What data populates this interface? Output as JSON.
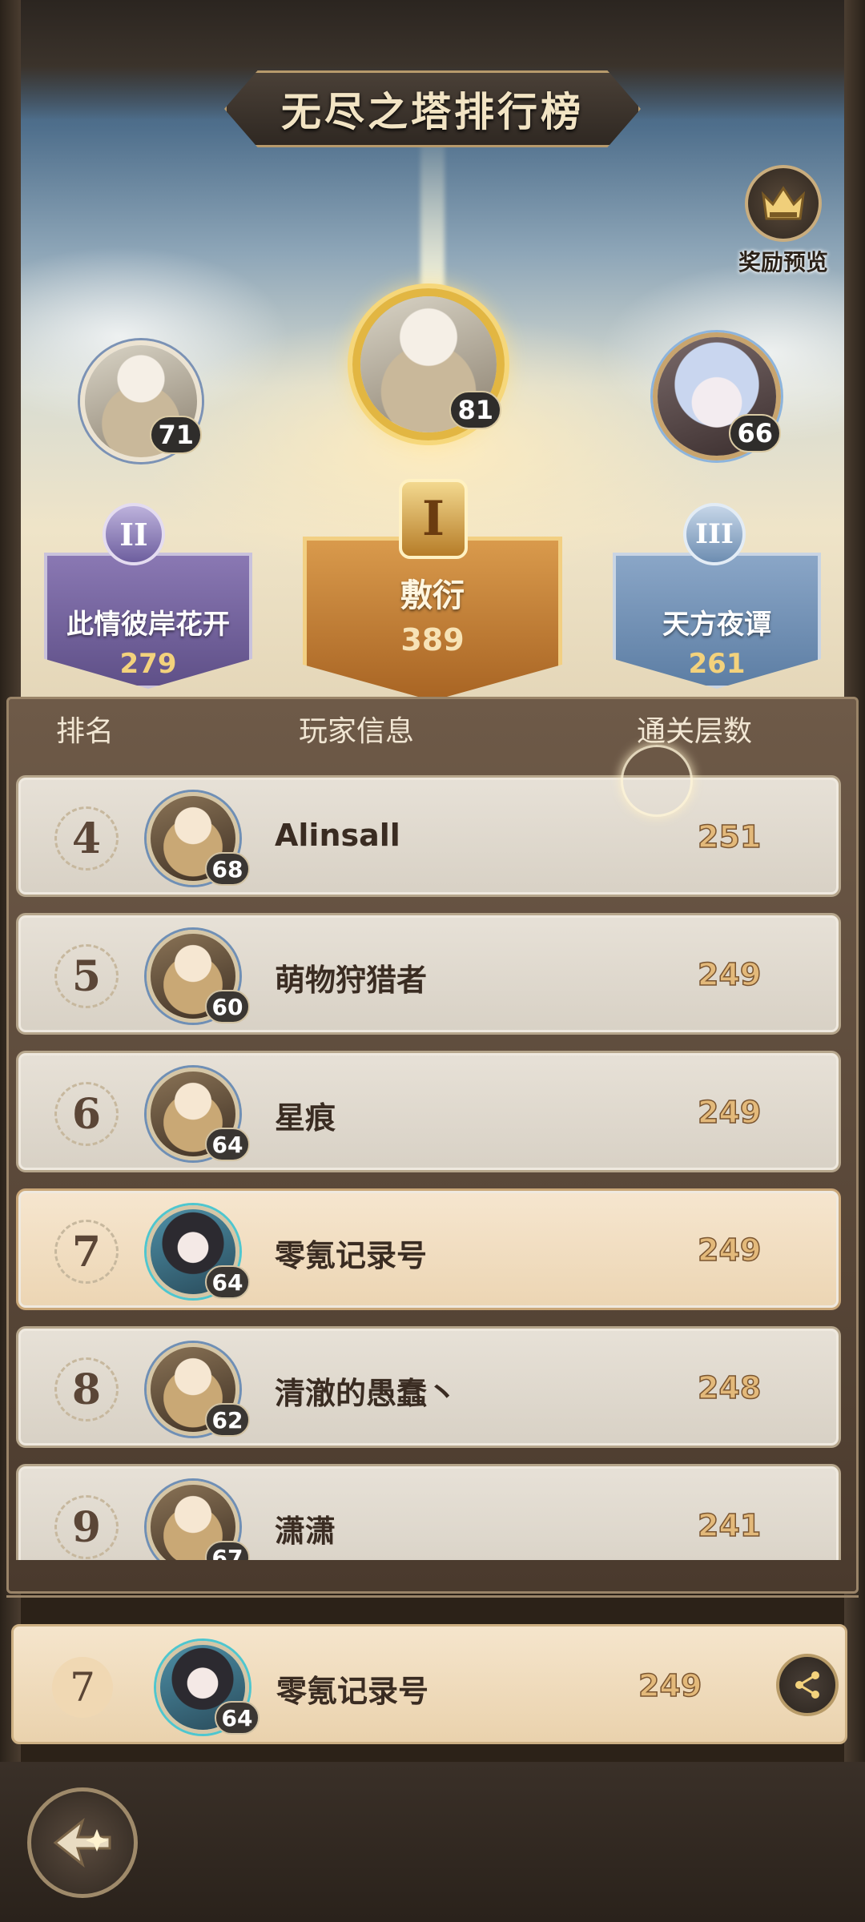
{
  "title": "无尽之塔排行榜",
  "reward_preview": {
    "label": "奖励预览",
    "icon": "crown-chest-icon"
  },
  "podium": [
    {
      "rank_badge": "I",
      "name": "敷衍",
      "score": "389",
      "level": "81"
    },
    {
      "rank_badge": "II",
      "name": "此情彼岸花开",
      "score": "279",
      "level": "71"
    },
    {
      "rank_badge": "III",
      "name": "天方夜谭",
      "score": "261",
      "level": "66"
    }
  ],
  "table": {
    "headers": {
      "rank": "排名",
      "player_info": "玩家信息",
      "floors": "通关层数"
    },
    "rows": [
      {
        "rank": "4",
        "name": "Alinsall",
        "level": "68",
        "score": "251"
      },
      {
        "rank": "5",
        "name": "萌物狩猎者",
        "level": "60",
        "score": "249"
      },
      {
        "rank": "6",
        "name": "星痕",
        "level": "64",
        "score": "249"
      },
      {
        "rank": "7",
        "name": "零氪记录号",
        "level": "64",
        "score": "249"
      },
      {
        "rank": "8",
        "name": "清澈的愚蠢丶",
        "level": "62",
        "score": "248"
      },
      {
        "rank": "9",
        "name": "潇潇",
        "level": "67",
        "score": "241"
      }
    ]
  },
  "my_entry": {
    "rank": "7",
    "name": "零氪记录号",
    "level": "64",
    "score": "249",
    "share_icon": "share-icon"
  },
  "back_button": {
    "icon": "back-arrow-icon"
  },
  "colors": {
    "gold": "#e2b642",
    "silver_purple": "#8a78b3",
    "bronze_blue": "#8aa6c7",
    "score": "#e3b97a"
  }
}
